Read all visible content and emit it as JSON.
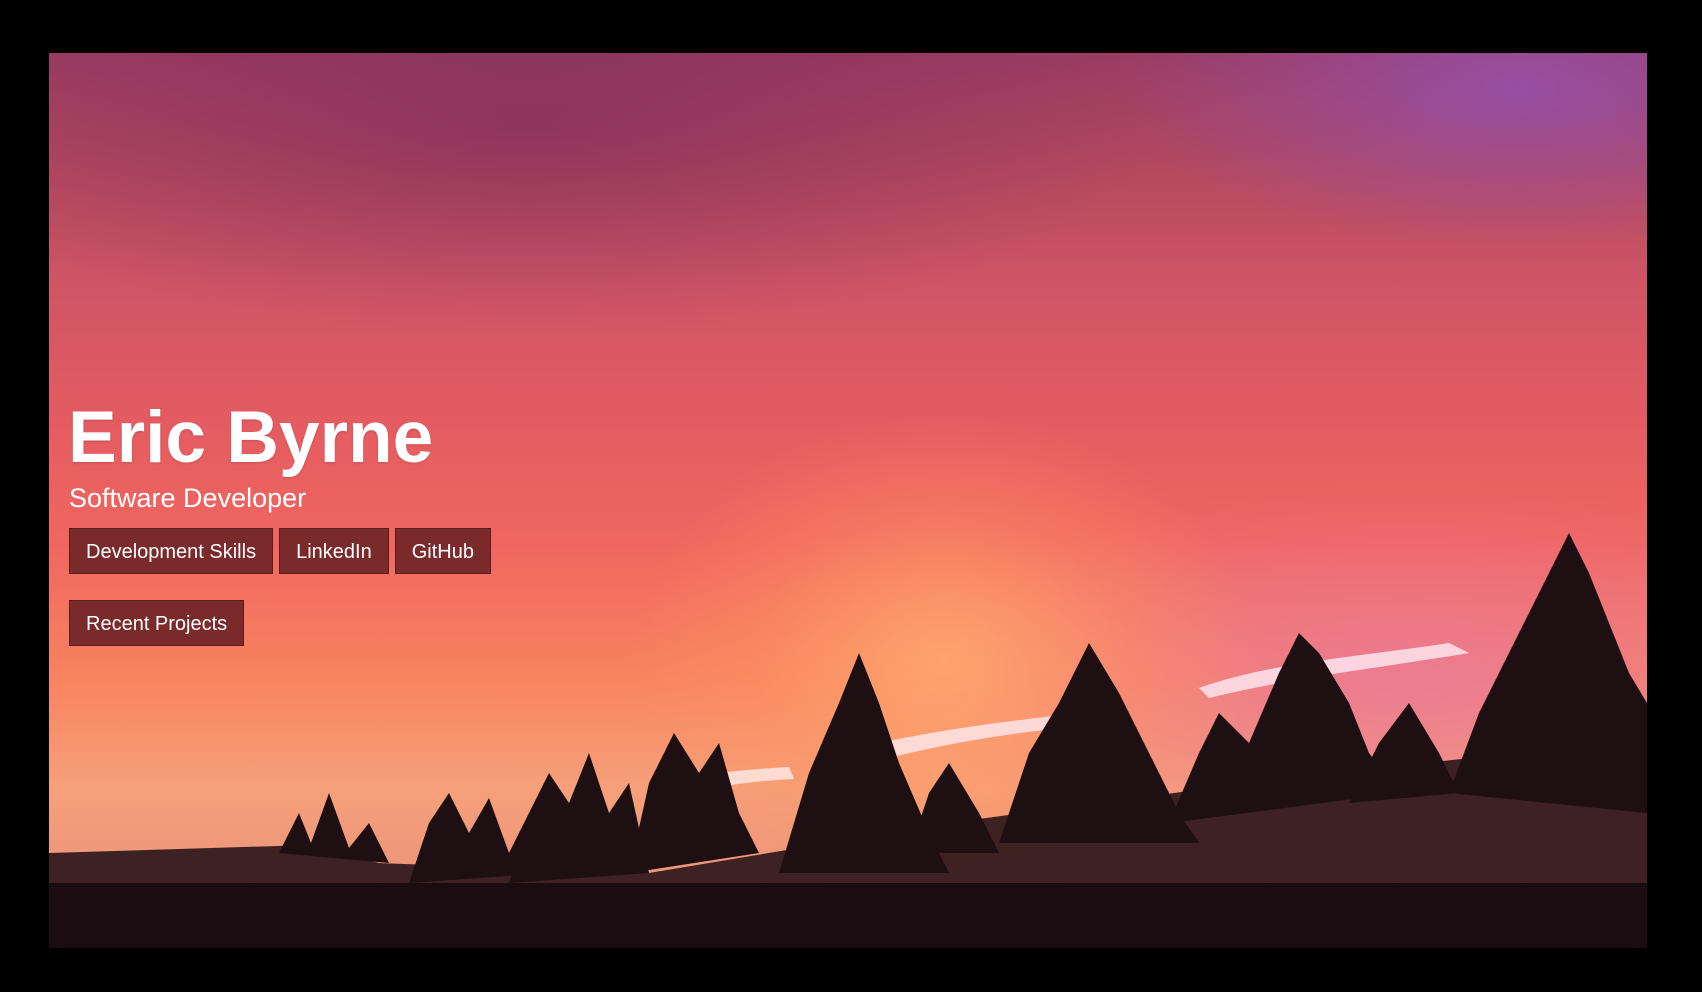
{
  "hero": {
    "name": "Eric Byrne",
    "subtitle": "Software Developer"
  },
  "nav": {
    "buttons": [
      {
        "label": "Development Skills"
      },
      {
        "label": "LinkedIn"
      },
      {
        "label": "GitHub"
      }
    ],
    "second_row": [
      {
        "label": "Recent Projects"
      }
    ]
  },
  "colors": {
    "button_bg": "#7a2a2b",
    "page_frame": "#000000",
    "text": "#ffffff"
  }
}
